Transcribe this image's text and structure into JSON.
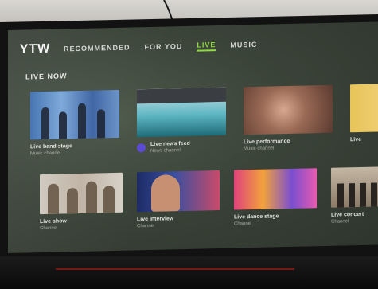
{
  "app": {
    "logo_text": "YTW"
  },
  "nav": {
    "items": [
      {
        "label": "RECOMMENDED",
        "active": false
      },
      {
        "label": "FOR YOU",
        "active": false
      },
      {
        "label": "LIVE",
        "active": true
      },
      {
        "label": "MUSIC",
        "active": false
      }
    ]
  },
  "section": {
    "title": "LIVE NOW"
  },
  "rows": [
    {
      "cards": [
        {
          "title": "Live band stage",
          "subtitle": "Music channel"
        },
        {
          "title": "Live news feed",
          "subtitle": "News channel"
        },
        {
          "title": "Live performance",
          "subtitle": "Music channel"
        },
        {
          "title": "Live",
          "subtitle": ""
        }
      ]
    },
    {
      "cards": [
        {
          "title": "Live show",
          "subtitle": "Channel"
        },
        {
          "title": "Live interview",
          "subtitle": "Channel"
        },
        {
          "title": "Live dance stage",
          "subtitle": "Channel"
        },
        {
          "title": "Live concert",
          "subtitle": "Channel"
        }
      ]
    }
  ],
  "colors": {
    "accent": "#8fdc3f",
    "screen_bg": "#3b4439",
    "avatar": "#5a4ad6"
  }
}
